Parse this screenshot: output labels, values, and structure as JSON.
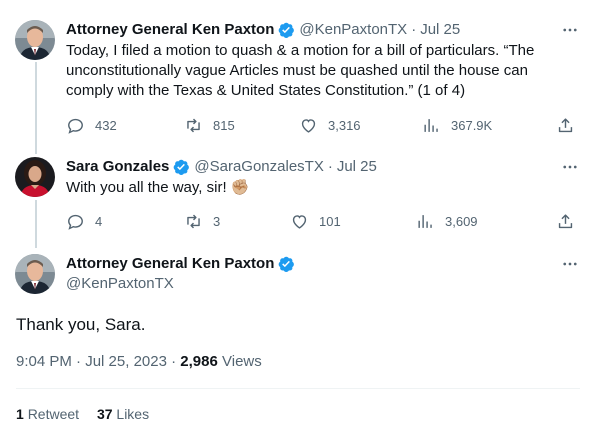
{
  "tweets": [
    {
      "name": "Attorney General Ken Paxton",
      "handle": "@KenPaxtonTX",
      "date": "Jul 25",
      "text": "Today, I filed a motion to quash & a motion for a bill of particulars. “The unconstitutionally vague Articles must be quashed until the house can comply with the Texas & United States Constitution.” (1 of 4)",
      "replies": "432",
      "retweets": "815",
      "likes": "3,316",
      "views": "367.9K"
    },
    {
      "name": "Sara Gonzales",
      "handle": "@SaraGonzalesTX",
      "date": "Jul 25",
      "text": "With you all the way, sir! ✊🏼",
      "replies": "4",
      "retweets": "3",
      "likes": "101",
      "views": "3,609"
    }
  ],
  "main": {
    "name": "Attorney General Ken Paxton",
    "handle": "@KenPaxtonTX",
    "text": "Thank you, Sara.",
    "time": "9:04 PM",
    "date": "Jul 25, 2023",
    "view_count": "2,986",
    "views_label": "Views",
    "retweets": "1",
    "retweets_label": "Retweet",
    "likes": "37",
    "likes_label": "Likes"
  },
  "separator": "·",
  "icons": {
    "verified": "verified-badge-icon",
    "more": "more-icon",
    "reply": "reply-icon",
    "retweet": "retweet-icon",
    "like": "like-icon",
    "views": "views-icon",
    "share": "share-icon"
  },
  "colors": {
    "verified": "#1d9bf0",
    "muted": "#536471",
    "text": "#0f1419",
    "thread_line": "#cfd9de"
  }
}
